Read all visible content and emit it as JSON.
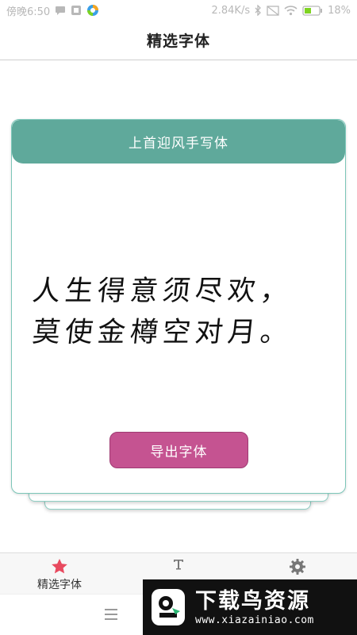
{
  "status_bar": {
    "time": "傍晚6:50",
    "network_speed": "2.84K/s",
    "battery": "18%",
    "icons": [
      "message-icon",
      "notification-icon",
      "app-icon",
      "bluetooth-icon",
      "sim-icon",
      "wifi-icon",
      "battery-icon"
    ]
  },
  "app_bar": {
    "title": "精选字体"
  },
  "card": {
    "header": "上首迎风手写体",
    "preview_lines": [
      "人生得意须尽欢，",
      "莫使金樽空对月。"
    ],
    "export_button": "导出字体"
  },
  "bottom_nav": {
    "items": [
      {
        "label": "精选字体",
        "icon": "star-icon",
        "active": true
      },
      {
        "label": "",
        "icon": "text-icon",
        "active": false
      },
      {
        "label": "",
        "icon": "gear-icon",
        "active": false
      }
    ]
  },
  "system_bar": {
    "icon": "menu-icon"
  },
  "watermark": {
    "title": "下载鸟资源",
    "url": "www.xiazainiao.com"
  },
  "colors": {
    "header_bg": "#5fa99b",
    "card_border": "#7cc7b9",
    "button_bg": "#c55391",
    "active_star": "#e84a5f",
    "inactive_icon": "#777777"
  }
}
